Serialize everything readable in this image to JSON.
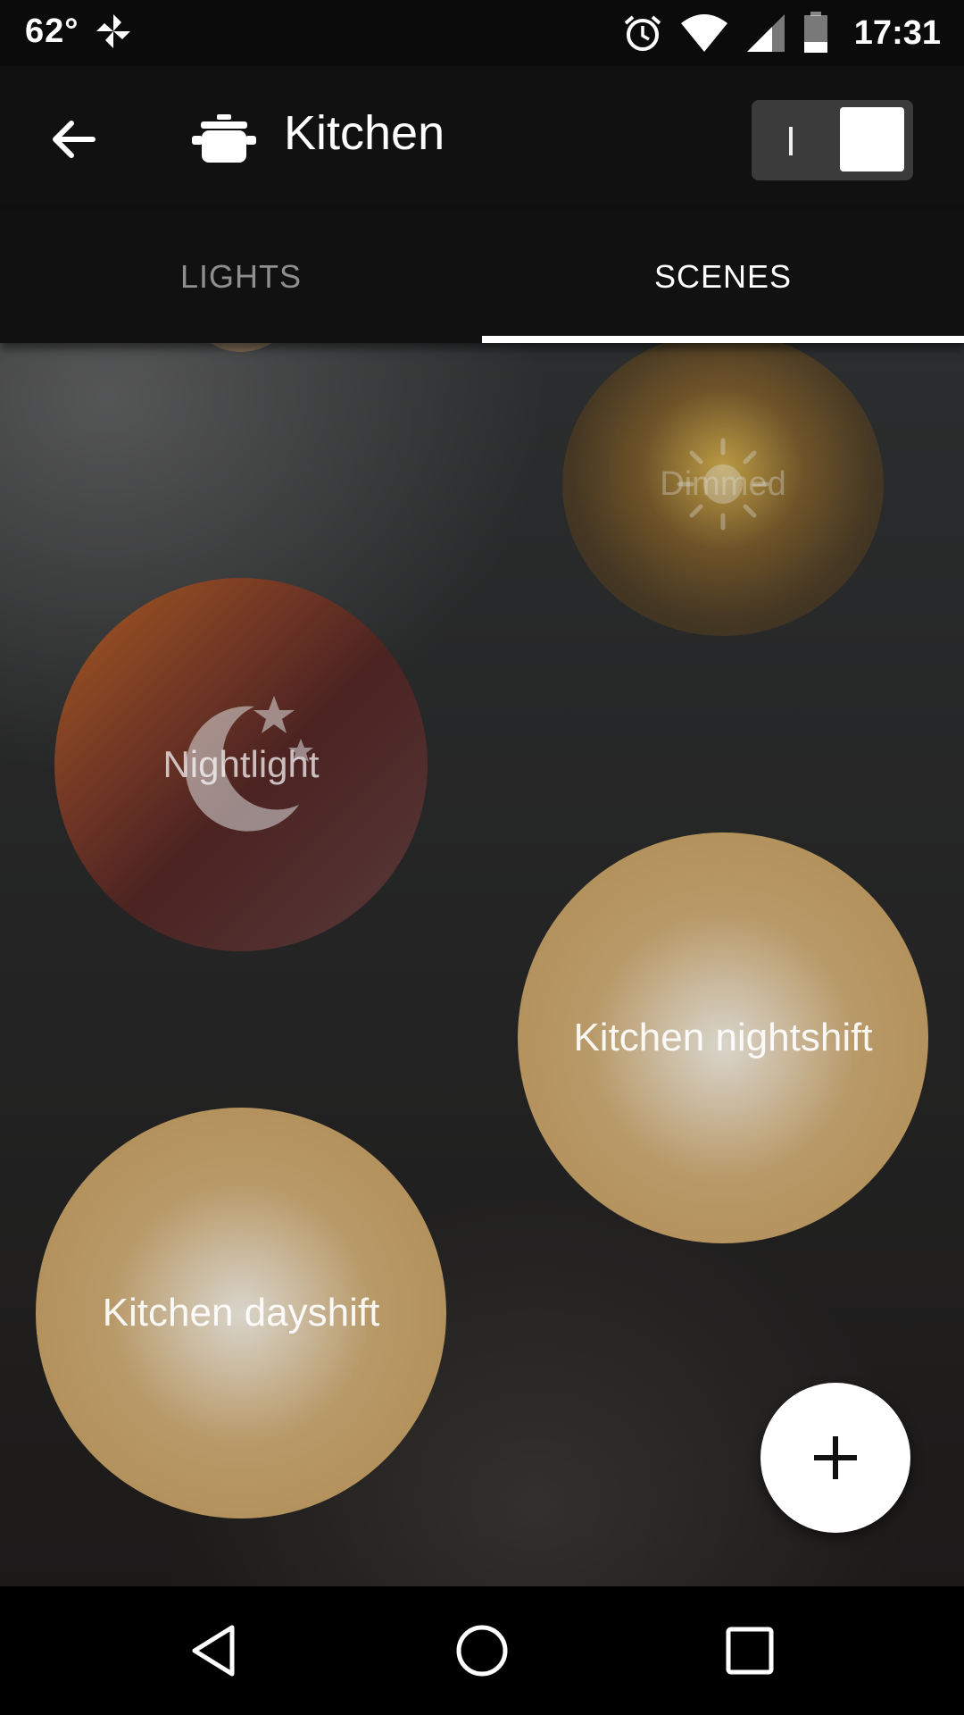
{
  "status_bar": {
    "temperature": "62°",
    "time": "17:31",
    "icons": [
      "pinwheel-icon",
      "alarm-icon",
      "wifi-icon",
      "signal-icon",
      "battery-icon"
    ]
  },
  "app_bar": {
    "title": "Kitchen",
    "room_icon": "cooking-pot-icon",
    "power_on": true
  },
  "tabs": [
    {
      "label": "LIGHTS",
      "active": false
    },
    {
      "label": "SCENES",
      "active": true
    }
  ],
  "scenes": [
    {
      "label": "Dimmed",
      "icon": "sun-icon"
    },
    {
      "label": "Nightlight",
      "icon": "moon-stars-icon"
    },
    {
      "label": "Kitchen nightshift"
    },
    {
      "label": "Kitchen dayshift"
    }
  ],
  "fab": {
    "icon": "plus-icon"
  },
  "nav_bar": {
    "icons": [
      "back-triangle-icon",
      "home-circle-icon",
      "recents-square-icon"
    ]
  },
  "colors": {
    "accent": "#ffffff",
    "background": "#111111",
    "scene_warm": "#b08a50",
    "nightlight": "#a85a22"
  }
}
